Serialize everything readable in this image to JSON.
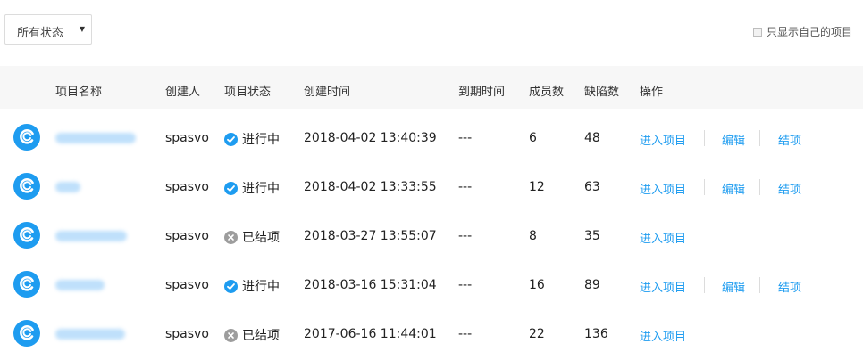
{
  "filter": {
    "status_value": "所有状态",
    "own_only_label": "只显示自己的项目"
  },
  "columns": [
    "项目名称",
    "创建人",
    "项目状态",
    "创建时间",
    "到期时间",
    "成员数",
    "缺陷数",
    "操作"
  ],
  "actions": {
    "enter": "进入项目",
    "edit": "编辑",
    "close": "结项"
  },
  "rows": [
    {
      "creator": "spasvo",
      "status": "进行中",
      "created": "2018-04-02 13:40:39",
      "due": "---",
      "members": "6",
      "defects": "48"
    },
    {
      "creator": "spasvo",
      "status": "进行中",
      "created": "2018-04-02 13:33:55",
      "due": "---",
      "members": "12",
      "defects": "63"
    },
    {
      "creator": "spasvo",
      "status": "已结项",
      "created": "2018-03-27 13:55:07",
      "due": "---",
      "members": "8",
      "defects": "35"
    },
    {
      "creator": "spasvo",
      "status": "进行中",
      "created": "2018-03-16 15:31:04",
      "due": "---",
      "members": "16",
      "defects": "89"
    },
    {
      "creator": "spasvo",
      "status": "已结项",
      "created": "2017-06-16 11:44:01",
      "due": "---",
      "members": "22",
      "defects": "136"
    }
  ],
  "colors": {
    "accent": "#1e9cf0",
    "closed": "#9d9d9d"
  }
}
